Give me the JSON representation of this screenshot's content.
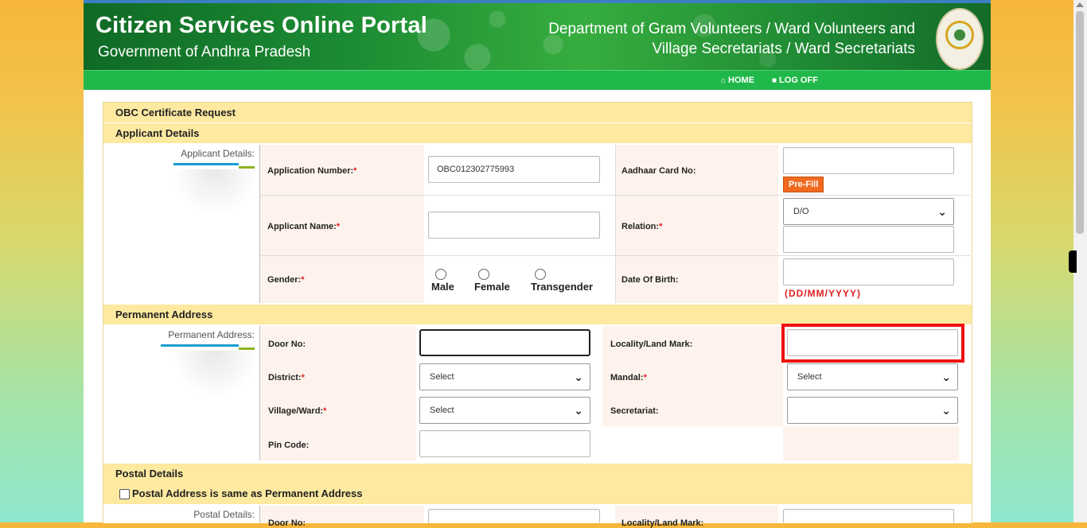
{
  "banner": {
    "title": "Citizen Services Online Portal",
    "subtitle": "Government of Andhra Pradesh",
    "department_line1": "Department of Gram Volunteers / Ward Volunteers and",
    "department_line2": "Village Secretariats / Ward Secretariats"
  },
  "nav": {
    "home": "HOME",
    "logoff": "LOG OFF"
  },
  "form": {
    "title": "OBC Certificate Request",
    "applicant_section": "Applicant Details",
    "applicant_side": "Applicant Details:",
    "application_number_label": "Application Number:",
    "application_number_value": "OBC012302775993",
    "aadhaar_label": "Aadhaar Card No:",
    "aadhaar_value": "",
    "prefill_button": "Pre-Fill",
    "applicant_name_label": "Applicant Name:",
    "applicant_name_value": "",
    "relation_label": "Relation:",
    "relation_selected": "D/O",
    "relation_name_value": "",
    "gender_label": "Gender:",
    "gender_options": [
      "Male",
      "Female",
      "Transgender"
    ],
    "dob_label": "Date Of Birth:",
    "dob_value": "",
    "dob_hint": "(DD/MM/YYYY)",
    "required_mark": "*",
    "permanent_section": "Permanent Address",
    "permanent_side": "Permanent Address:",
    "door_label": "Door No:",
    "door_value": "",
    "locality_label": "Locality/Land Mark:",
    "locality_value": "",
    "district_label": "District:",
    "district_selected": "Select",
    "mandal_label": "Mandal:",
    "mandal_selected": "Select",
    "village_label": "Village/Ward:",
    "village_selected": "Select",
    "secretariat_label": "Secretariat:",
    "secretariat_selected": "",
    "pin_label": "Pin Code:",
    "pin_value": "",
    "postal_section": "Postal Details",
    "postal_same_label": "Postal Address is same as Permanent Address",
    "postal_side": "Postal Details:",
    "postal_door_label": "Door No:",
    "postal_locality_label": "Locality/Land Mark:"
  },
  "colors": {
    "banner_green": "#1d8c33",
    "nav_green": "#20b84a",
    "section_header": "#fde9a0",
    "required": "#e02020",
    "prefill": "#f06a1f",
    "highlight": "#ee1111"
  },
  "icons": {
    "home": "home-icon",
    "logoff": "lock-icon",
    "dropdown": "chevron-down-icon"
  }
}
